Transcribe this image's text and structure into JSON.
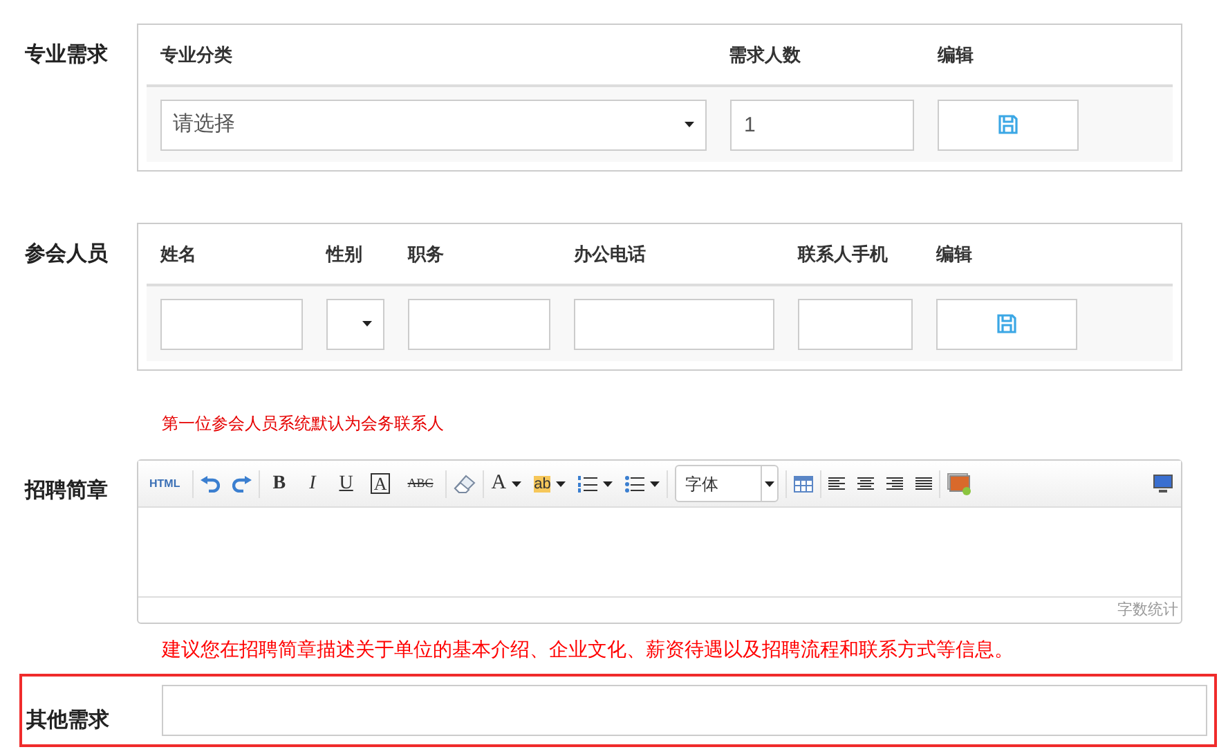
{
  "major_demand": {
    "label": "专业需求",
    "columns": [
      "专业分类",
      "需求人数",
      "编辑"
    ],
    "row": {
      "category_placeholder": "请选择",
      "count_value": "1"
    }
  },
  "attendees": {
    "label": "参会人员",
    "columns": [
      "姓名",
      "性别",
      "职务",
      "办公电话",
      "联系人手机",
      "编辑"
    ],
    "note": "第一位参会人员系统默认为会务联系人"
  },
  "brochure": {
    "label": "招聘简章",
    "toolbar": [
      [
        {
          "kind": "html",
          "label": "HTML"
        }
      ],
      [
        {
          "kind": "undo"
        },
        {
          "kind": "redo"
        }
      ],
      [
        {
          "kind": "bold",
          "label": "B"
        },
        {
          "kind": "italic",
          "label": "I"
        },
        {
          "kind": "underline",
          "label": "U"
        },
        {
          "kind": "framed",
          "label": "A"
        },
        {
          "kind": "strike",
          "label": "ABC"
        }
      ],
      [
        {
          "kind": "eraser"
        }
      ],
      [
        {
          "kind": "fontcolor",
          "label": "A"
        },
        {
          "kind": "highlight",
          "label": "ab"
        },
        {
          "kind": "orderedlist"
        },
        {
          "kind": "bulletlist"
        }
      ],
      [
        {
          "kind": "fontselect",
          "label": "字体"
        }
      ],
      [
        {
          "kind": "table"
        }
      ],
      [
        {
          "kind": "alignleft"
        },
        {
          "kind": "aligncenter"
        },
        {
          "kind": "alignright"
        },
        {
          "kind": "justify"
        }
      ],
      [
        {
          "kind": "image"
        }
      ]
    ],
    "word_count": "字数统计",
    "hint": "建议您在招聘简章描述关于单位的基本介绍、企业文化、薪资待遇以及招聘流程和联系方式等信息。"
  },
  "other": {
    "label": "其他需求",
    "highlighted": true
  }
}
